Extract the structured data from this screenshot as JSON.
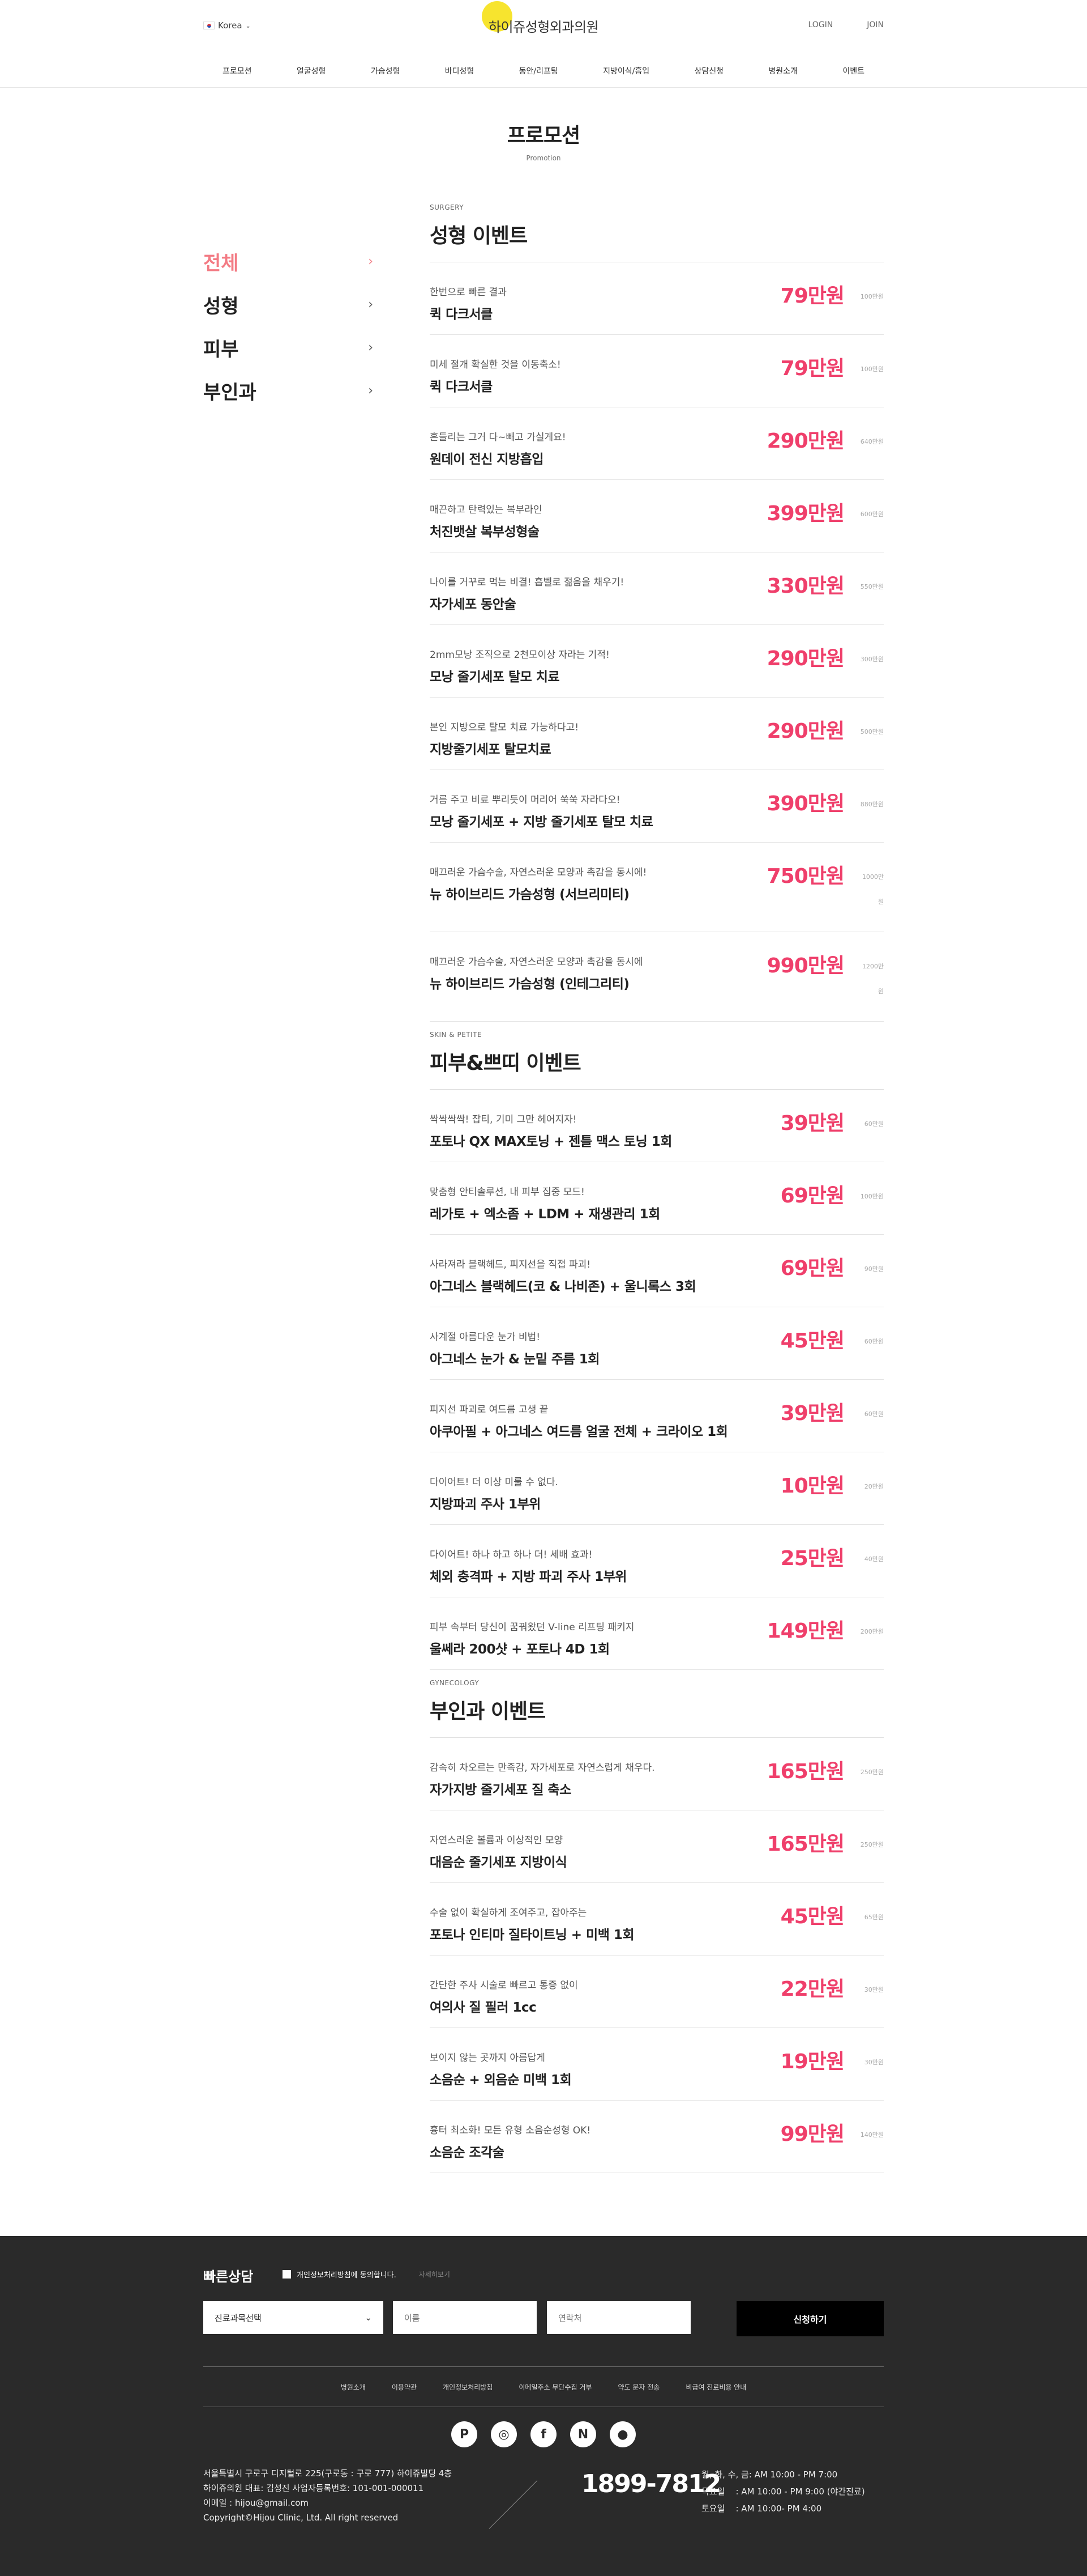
{
  "header": {
    "lang": "Korea",
    "logo": "하이쥬성형외과의원",
    "login": "LOGIN",
    "join": "JOIN",
    "nav": [
      "프로모션",
      "얼굴성형",
      "가슴성형",
      "바디성형",
      "동안/리프팅",
      "지방이식/흡입",
      "상담신청",
      "병원소개",
      "이벤트"
    ]
  },
  "page": {
    "title": "프로모션",
    "subtitle": "Promotion"
  },
  "lnb": [
    {
      "label": "전체",
      "active": true
    },
    {
      "label": "성형",
      "active": false
    },
    {
      "label": "피부",
      "active": false
    },
    {
      "label": "부인과",
      "active": false
    }
  ],
  "sections": [
    {
      "eng": "SURGERY",
      "title": "성형 이벤트",
      "items": [
        {
          "desc": "한번으로 빠른 결과",
          "name": "퀵 다크서클",
          "price": "79만원",
          "orig": "100만원"
        },
        {
          "desc": "미세 절개 확실한 것을 이동축소!",
          "name": "퀵 다크서클",
          "price": "79만원",
          "orig": "100만원"
        },
        {
          "desc": "흔들리는 그거 다~빼고 가실게요!",
          "name": "원데이 전신 지방흡입",
          "price": "290만원",
          "orig": "640만원"
        },
        {
          "desc": "매끈하고 탄력있는 복부라인",
          "name": "처진뱃살 복부성형술",
          "price": "399만원",
          "orig": "600만원"
        },
        {
          "desc": "나이를 거꾸로 먹는 비결! 흡벨로 젊음을 채우기!",
          "name": "자가세포 동안술",
          "price": "330만원",
          "orig": "550만원"
        },
        {
          "desc": "2mm모낭 조직으로 2천모이상 자라는 기적!",
          "name": "모낭 줄기세포 탈모 치료",
          "price": "290만원",
          "orig": "300만원"
        },
        {
          "desc": "본인 지방으로 탈모 치료 가능하다고!",
          "name": "지방줄기세포 탈모치료",
          "price": "290만원",
          "orig": "500만원"
        },
        {
          "desc": "거름 주고 비료 뿌리듯이 머리어 쑥쑥 자라다오!",
          "name": "모낭 줄기세포 + 지방 줄기세포 탈모 치료",
          "price": "390만원",
          "orig": "880만원"
        },
        {
          "desc": "매끄러운 가슴수술, 자연스러운 모양과 촉감을 동시에!",
          "name": "뉴 하이브리드 가슴성형 (서브리미티)",
          "price": "750만원",
          "orig": "1000만",
          "tail": "원",
          "tall": true
        },
        {
          "desc": "매끄러운 가슴수술, 자연스러운 모양과 촉감을 동시에",
          "name": "뉴 하이브리드 가슴성형 (인테그리티)",
          "price": "990만원",
          "orig": "1200만",
          "tail": "원",
          "tall": true
        }
      ]
    },
    {
      "eng": "SKIN & PETITE",
      "title": "피부&쁘띠 이벤트",
      "items": [
        {
          "desc": "싹싹싹싹! 잡티, 기미 그만 헤어지자!",
          "name": "포토나 QX MAX토닝 + 젠틀 맥스 토닝 1회",
          "price": "39만원",
          "orig": "60만원"
        },
        {
          "desc": "맞춤형 안티솔루션, 내 피부 집중 모드!",
          "name": "레가토 + 엑소좀 + LDM + 재생관리 1회",
          "price": "69만원",
          "orig": "100만원"
        },
        {
          "desc": "사라져라 블랙헤드, 피지선을 직접 파괴!",
          "name": "아그네스 블랙헤드(코 & 나비존) + 울니록스 3회",
          "price": "69만원",
          "orig": "90만원"
        },
        {
          "desc": "사계절 아름다운 눈가 비법!",
          "name": "아그네스 눈가 & 눈밑 주름 1회",
          "price": "45만원",
          "orig": "60만원"
        },
        {
          "desc": "피지선 파괴로 여드름 고생 끝",
          "name": "아쿠아필 + 아그네스 여드름 얼굴 전체 + 크라이오 1회",
          "price": "39만원",
          "orig": "60만원"
        },
        {
          "desc": "다이어트! 더 이상 미룰 수 없다.",
          "name": "지방파괴 주사 1부위",
          "price": "10만원",
          "orig": "20만원"
        },
        {
          "desc": "다이어트! 하나 하고 하나 더! 세배 효과!",
          "name": "체외 충격파 + 지방 파괴 주사 1부위",
          "price": "25만원",
          "orig": "40만원"
        },
        {
          "desc": "피부 속부터 당신이 꿈꿔왔던 V-line 리프팅 패키지",
          "name": "울쎄라 200샷 + 포토나 4D 1회",
          "price": "149만원",
          "orig": "200만원"
        }
      ]
    },
    {
      "eng": "GYNECOLOGY",
      "title": "부인과 이벤트",
      "items": [
        {
          "desc": "감속히 차오르는 만족감, 자가세포로 자연스럽게 채우다.",
          "name": "자가지방 줄기세포 질 축소",
          "price": "165만원",
          "orig": "250만원"
        },
        {
          "desc": "자연스러운 볼륨과 이상적인 모양",
          "name": "대음순 줄기세포 지방이식",
          "price": "165만원",
          "orig": "250만원"
        },
        {
          "desc": "수술 없이 확실하게 조여주고, 잡아주는",
          "name": "포토나 인티마 질타이트닝 + 미백 1회",
          "price": "45만원",
          "orig": "65만원"
        },
        {
          "desc": "간단한 주사 시술로 빠르고 통증 없이",
          "name": "여의사 질 필러 1cc",
          "price": "22만원",
          "orig": "30만원"
        },
        {
          "desc": "보이지 않는 곳까지 아름답게",
          "name": "소음순 + 외음순 미백 1회",
          "price": "19만원",
          "orig": "30만원"
        },
        {
          "desc": "흉터 최소화! 모든 유형 소음순성형 OK!",
          "name": "소음순 조각술",
          "price": "99만원",
          "orig": "140만원"
        }
      ]
    }
  ],
  "footer": {
    "quick_title": "빠른상담",
    "agree": "개인정보처리방침에 동의합니다.",
    "agree_view": "자세히보기",
    "select": "진료과목선택",
    "name_placeholder": "이름",
    "phone_placeholder": "연락처",
    "apply": "신청하기",
    "nav": [
      "병원소개",
      "이용약관",
      "개인정보처리방침",
      "이메일주소 무단수집 거부",
      "약도 문자 전송",
      "비급여 진료비용 안내"
    ],
    "sns": [
      "P",
      "◎",
      "f",
      "N",
      "●"
    ],
    "address": [
      "서울특별시 구로구 디지털로 225(구로동 : 구로 777) 하이쥬빌딩 4층",
      "하이쥬의원 대표: 김성진 사업자등록번호: 101-001-000011",
      "이메일 : hijou@gmail.com",
      "Copyright©Hijou Clinic, Ltd. All right reserved"
    ],
    "phone": "1899-7812",
    "hours": [
      "월, 화, 수, 금: AM 10:00 - PM 7:00",
      "목요일    : AM 10:00 - PM 9:00 (야간진료)",
      "토요일    : AM 10:00- PM 4:00"
    ]
  }
}
